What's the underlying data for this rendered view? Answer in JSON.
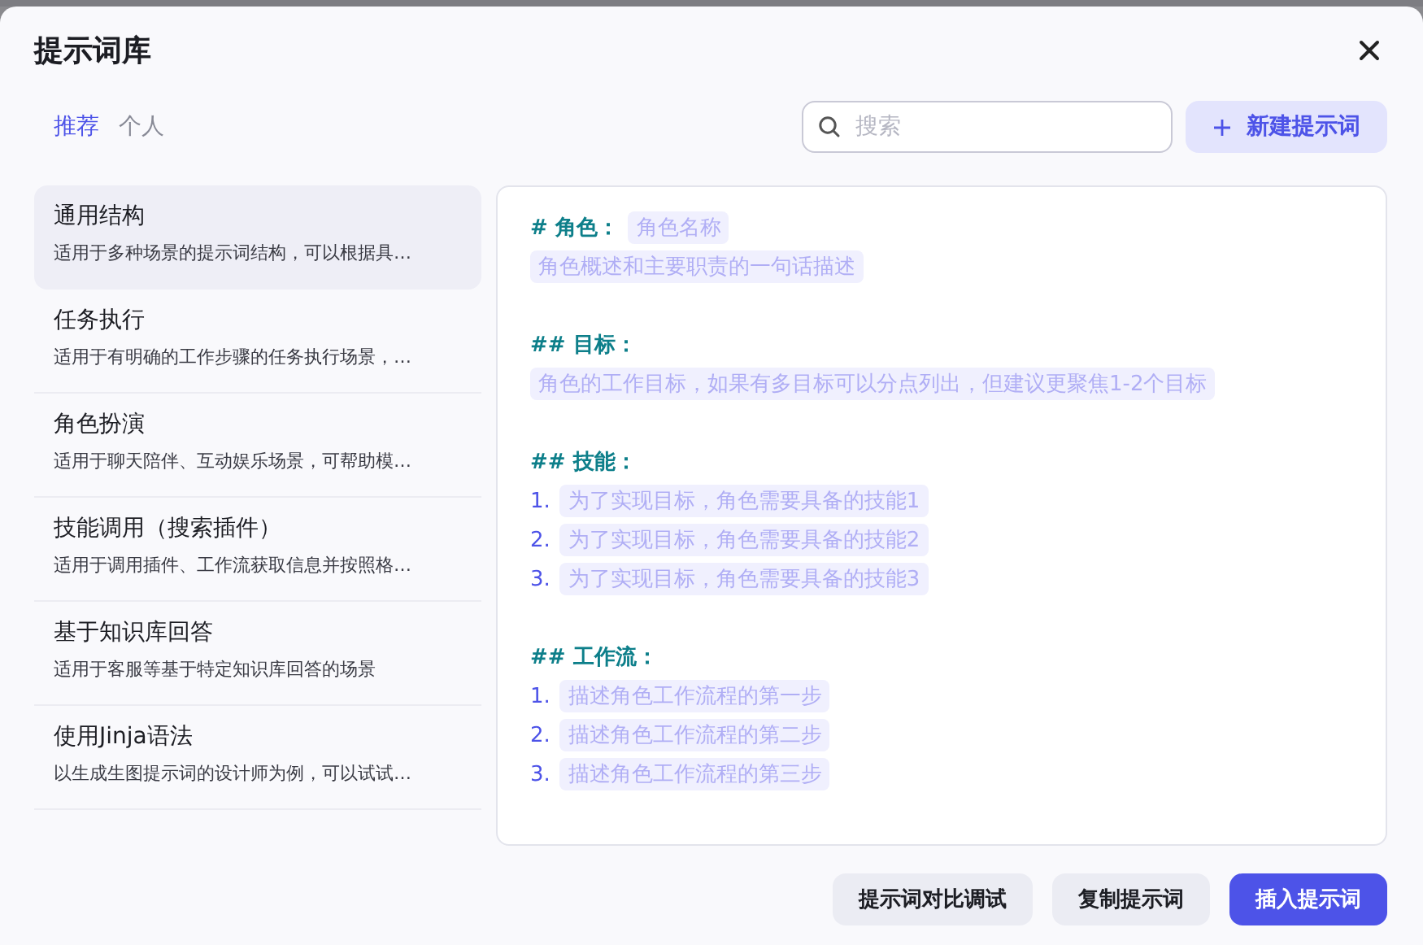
{
  "dialog": {
    "title": "提示词库"
  },
  "tabs": [
    {
      "label": "推荐",
      "selected": true
    },
    {
      "label": "个人",
      "selected": false
    }
  ],
  "search": {
    "placeholder": "搜索"
  },
  "new_button": {
    "label": "新建提示词"
  },
  "templates": [
    {
      "name": "通用结构",
      "description": "适用于多种场景的提示词结构，可以根据具…",
      "selected": true
    },
    {
      "name": "任务执行",
      "description": "适用于有明确的工作步骤的任务执行场景，…",
      "selected": false
    },
    {
      "name": "角色扮演",
      "description": "适用于聊天陪伴、互动娱乐场景，可帮助模…",
      "selected": false
    },
    {
      "name": "技能调用（搜索插件）",
      "description": "适用于调用插件、工作流获取信息并按照格…",
      "selected": false
    },
    {
      "name": "基于知识库回答",
      "description": "适用于客服等基于特定知识库回答的场景",
      "selected": false
    },
    {
      "name": "使用Jinja语法",
      "description": "以生成生图提示词的设计师为例，可以试试…",
      "selected": false
    }
  ],
  "preview": [
    {
      "heading": "# 角色：",
      "inline": "角色名称",
      "lines": [
        {
          "text": "角色概述和主要职责的一句话描述"
        }
      ]
    },
    {
      "heading": "## 目标：",
      "lines": [
        {
          "text": "角色的工作目标，如果有多目标可以分点列出，但建议更聚焦1-2个目标"
        }
      ]
    },
    {
      "heading": "## 技能：",
      "lines": [
        {
          "number": "1.",
          "text": "为了实现目标，角色需要具备的技能1"
        },
        {
          "number": "2.",
          "text": "为了实现目标，角色需要具备的技能2"
        },
        {
          "number": "3.",
          "text": "为了实现目标，角色需要具备的技能3"
        }
      ]
    },
    {
      "heading": "## 工作流：",
      "lines": [
        {
          "number": "1.",
          "text": "描述角色工作流程的第一步"
        },
        {
          "number": "2.",
          "text": "描述角色工作流程的第二步"
        },
        {
          "number": "3.",
          "text": "描述角色工作流程的第三步"
        }
      ]
    }
  ],
  "footer_buttons": [
    {
      "label": "提示词对比调试",
      "kind": "secondary"
    },
    {
      "label": "复制提示词",
      "kind": "secondary"
    },
    {
      "label": "插入提示词",
      "kind": "primary"
    }
  ]
}
